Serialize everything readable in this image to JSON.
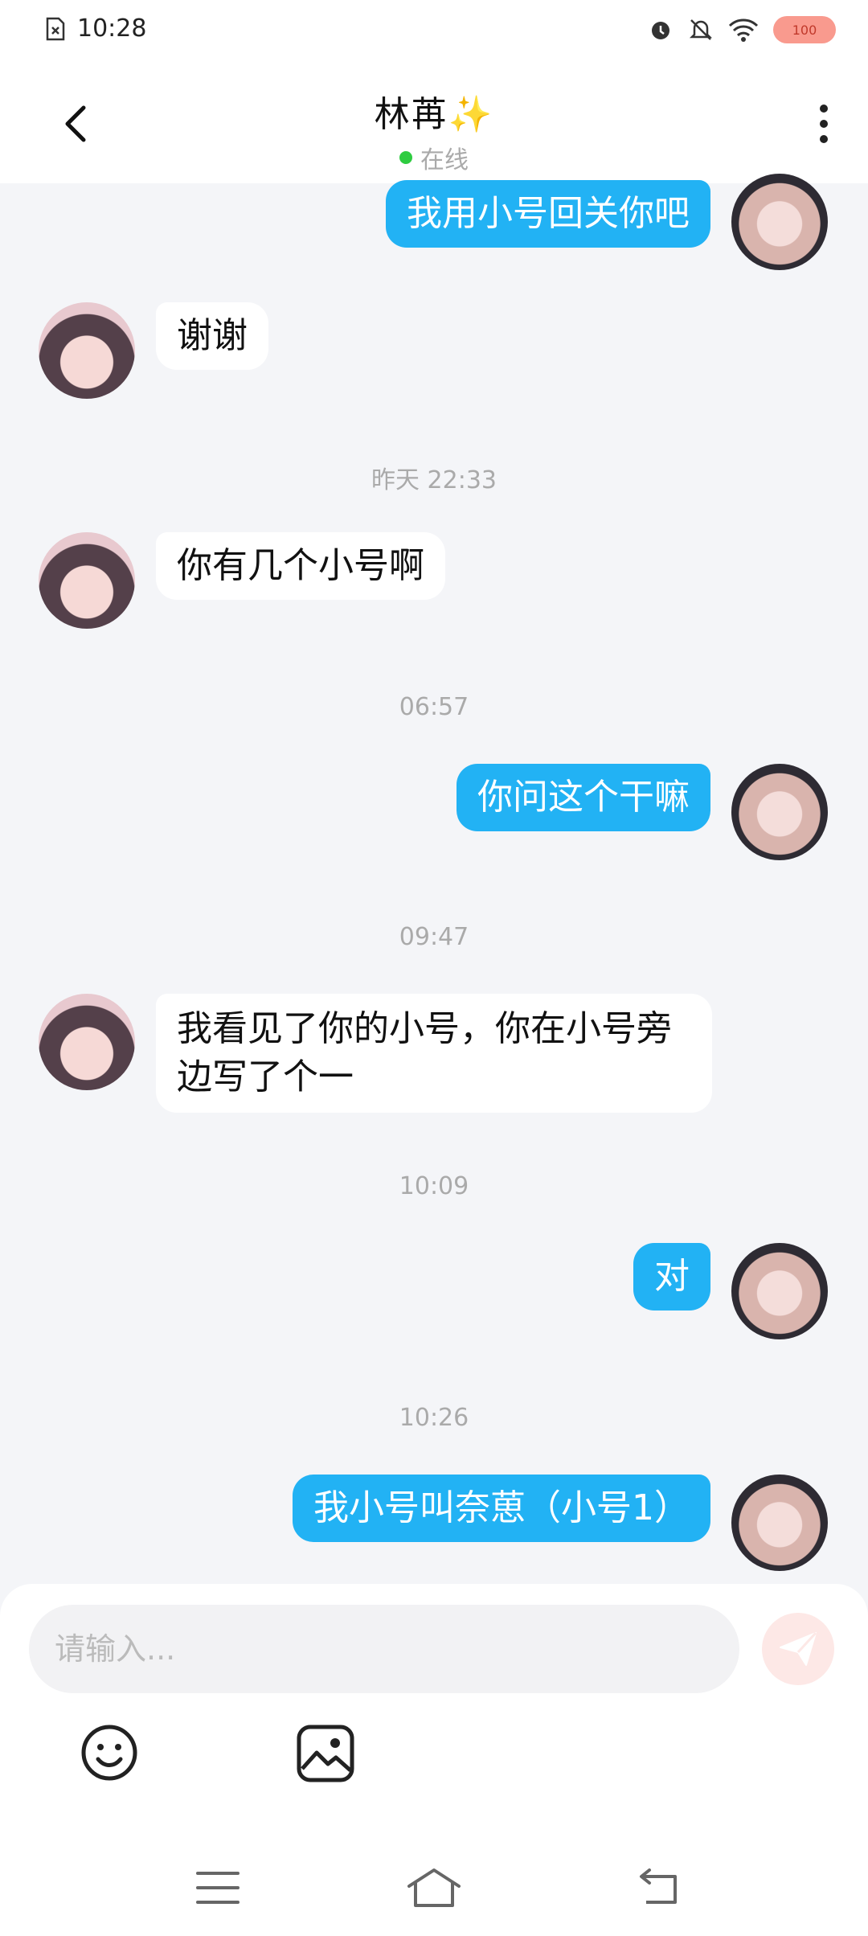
{
  "status_bar": {
    "time": "10:28",
    "battery": "100"
  },
  "header": {
    "title": "林苒✨",
    "status": "在线"
  },
  "messages": [
    {
      "from": "me",
      "text": "我用小号回关你吧"
    },
    {
      "from": "other",
      "text": "谢谢"
    },
    {
      "time": "昨天 22:33"
    },
    {
      "from": "other",
      "text": "你有几个小号啊"
    },
    {
      "time": "06:57"
    },
    {
      "from": "me",
      "text": "你问这个干嘛"
    },
    {
      "time": "09:47"
    },
    {
      "from": "other",
      "text": "我看见了你的小号，你在小号旁边写了个一"
    },
    {
      "time": "10:09"
    },
    {
      "from": "me",
      "text": "对"
    },
    {
      "time": "10:26"
    },
    {
      "from": "me",
      "text": "我小号叫奈葸（小号1）"
    }
  ],
  "input": {
    "placeholder": "请输入..."
  },
  "colors": {
    "bubble_me": "#22b2f4",
    "bubble_other": "#ffffff",
    "online": "#2ecc40",
    "background": "#f4f5f8"
  },
  "icons": {
    "back": "chevron-left-icon",
    "more": "more-vertical-icon",
    "send": "send-icon",
    "emoji": "emoji-icon",
    "image": "image-icon",
    "menu": "menu-icon",
    "home": "home-icon",
    "return": "back-nav-icon"
  }
}
